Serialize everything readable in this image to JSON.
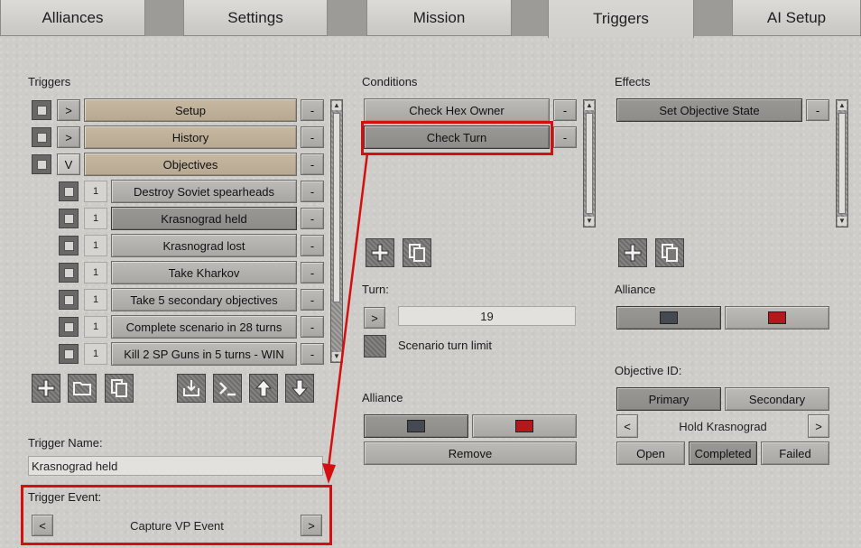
{
  "tabs": [
    {
      "label": "Alliances"
    },
    {
      "label": "Settings"
    },
    {
      "label": "Mission"
    },
    {
      "label": "Triggers"
    },
    {
      "label": "AI Setup"
    }
  ],
  "triggers": {
    "label": "Triggers",
    "groups": [
      {
        "expander": ">",
        "name": "Setup"
      },
      {
        "expander": ">",
        "name": "History"
      },
      {
        "expander": "V",
        "name": "Objectives"
      }
    ],
    "items": [
      {
        "num": "1",
        "name": "Destroy Soviet spearheads"
      },
      {
        "num": "1",
        "name": "Krasnograd held"
      },
      {
        "num": "1",
        "name": "Krasnograd lost"
      },
      {
        "num": "1",
        "name": "Take Kharkov"
      },
      {
        "num": "1",
        "name": "Take 5 secondary objectives"
      },
      {
        "num": "1",
        "name": "Complete scenario in 28 turns"
      },
      {
        "num": "1",
        "name": "Kill 2 SP Guns in 5 turns - WIN"
      }
    ],
    "remove_label": "-",
    "name_label": "Trigger Name:",
    "name_value": "Krasnograd held",
    "event_label": "Trigger Event:",
    "event_value": "Capture VP Event",
    "prev": "<",
    "next": ">"
  },
  "conditions": {
    "label": "Conditions",
    "items": [
      {
        "name": "Check Hex Owner"
      },
      {
        "name": "Check Turn"
      }
    ],
    "turn_label": "Turn:",
    "turn_btn": ">",
    "turn_value": "19",
    "turn_limit_label": "Scenario turn limit",
    "alliance_label": "Alliance",
    "remove_button": "Remove"
  },
  "effects": {
    "label": "Effects",
    "items": [
      {
        "name": "Set Objective State"
      }
    ],
    "alliance_label": "Alliance",
    "objective_id_label": "Objective ID:",
    "primary": "Primary",
    "secondary": "Secondary",
    "objective_name": "Hold Krasnograd",
    "prev": "<",
    "next": ">",
    "open": "Open",
    "completed": "Completed",
    "failed": "Failed"
  },
  "colors": {
    "allied_swatch": "#454a52",
    "enemy_swatch": "#b3191c",
    "highlight": "#d40f0f"
  },
  "icons": [
    "add-icon",
    "folder-icon",
    "copy-icon",
    "import-icon",
    "script-icon",
    "arrow-up-icon",
    "arrow-down-icon"
  ]
}
